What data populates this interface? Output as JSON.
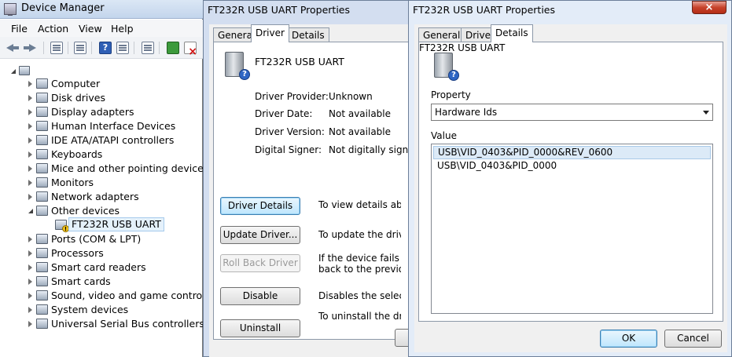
{
  "device_manager": {
    "title": "Device Manager",
    "menu": [
      "File",
      "Action",
      "View",
      "Help"
    ],
    "toolbar_icons": [
      "back-icon",
      "forward-icon",
      "show-hide-console-tree-icon",
      "properties-icon",
      "help-icon",
      "refresh-icon",
      "scan-hardware-icon",
      "update-driver-icon",
      "uninstall-icon"
    ],
    "tree": [
      {
        "label": "Computer",
        "expanded": false
      },
      {
        "label": "Disk drives",
        "expanded": false
      },
      {
        "label": "Display adapters",
        "expanded": false
      },
      {
        "label": "Human Interface Devices",
        "expanded": false
      },
      {
        "label": "IDE ATA/ATAPI controllers",
        "expanded": false
      },
      {
        "label": "Keyboards",
        "expanded": false
      },
      {
        "label": "Mice and other pointing devices",
        "expanded": false
      },
      {
        "label": "Monitors",
        "expanded": false
      },
      {
        "label": "Network adapters",
        "expanded": false
      },
      {
        "label": "Other devices",
        "expanded": true
      },
      {
        "label": "FT232R USB UART",
        "child": true,
        "selected": true,
        "warning": true
      },
      {
        "label": "Ports (COM & LPT)",
        "expanded": false
      },
      {
        "label": "Processors",
        "expanded": false
      },
      {
        "label": "Smart card readers",
        "expanded": false
      },
      {
        "label": "Smart cards",
        "expanded": false
      },
      {
        "label": "Sound, video and game controllers",
        "expanded": false
      },
      {
        "label": "System devices",
        "expanded": false
      },
      {
        "label": "Universal Serial Bus controllers",
        "expanded": false
      }
    ]
  },
  "driver_dialog": {
    "title": "FT232R USB UART Properties",
    "tabs": [
      "General",
      "Driver",
      "Details"
    ],
    "active_tab": "Driver",
    "device_name": "FT232R USB UART",
    "props": [
      {
        "label": "Driver Provider:",
        "value": "Unknown"
      },
      {
        "label": "Driver Date:",
        "value": "Not available"
      },
      {
        "label": "Driver Version:",
        "value": "Not available"
      },
      {
        "label": "Digital Signer:",
        "value": "Not digitally signed"
      }
    ],
    "buttons": [
      {
        "label": "Driver Details",
        "desc": "To view details about t",
        "state": "focused"
      },
      {
        "label": "Update Driver...",
        "desc": "To update the driver so",
        "state": "normal"
      },
      {
        "label": "Roll Back Driver",
        "desc": "If the device fails after\nback to the previously",
        "state": "disabled"
      },
      {
        "label": "Disable",
        "desc": "Disables the selected d",
        "state": "normal"
      },
      {
        "label": "Uninstall",
        "desc": "To uninstall the driver (",
        "state": "normal"
      }
    ]
  },
  "details_dialog": {
    "title": "FT232R USB UART Properties",
    "close_label": "×",
    "tabs": [
      "General",
      "Driver",
      "Details"
    ],
    "active_tab": "Details",
    "device_name": "FT232R USB UART",
    "property_label": "Property",
    "property_value": "Hardware Ids",
    "value_label": "Value",
    "values": [
      "USB\\VID_0403&PID_0000&REV_0600",
      "USB\\VID_0403&PID_0000"
    ],
    "ok_label": "OK",
    "cancel_label": "Cancel"
  },
  "colors": {
    "title_bar": "#c3d5ec",
    "selection": "#dceaf7",
    "close_button": "#c7432b",
    "warning": "#f2c21b"
  }
}
